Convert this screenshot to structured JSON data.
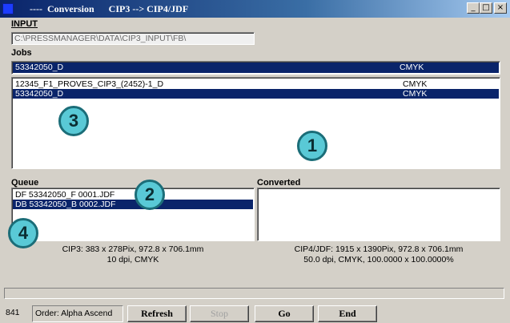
{
  "window": {
    "title": "----  Conversion      CIP3 --> CIP4/JDF",
    "minimize": "_",
    "maximize": "□",
    "close": "×"
  },
  "input": {
    "label": "INPUT",
    "path": "C:\\PRESSMANAGER\\DATA\\CIP3_INPUT\\FB\\"
  },
  "jobs": {
    "label": "Jobs",
    "selected": {
      "name": "53342050_D",
      "color": "CMYK"
    },
    "items": [
      {
        "name": "12345_F1_PROVES_CIP3_(2452)-1_D",
        "color": "CMYK"
      },
      {
        "name": "53342050_D",
        "color": "CMYK"
      }
    ]
  },
  "queue": {
    "label": "Queue",
    "items": [
      "DF 53342050_F 0001.JDF",
      "DB 53342050_B 0002.JDF"
    ],
    "info_line1": "CIP3:  383 x  278Pix, 972.8 x 706.1mm",
    "info_line2": "10 dpi, CMYK"
  },
  "converted": {
    "label": "Converted",
    "info_line1": "CIP4/JDF: 1915 x 1390Pix, 972.8 x 706.1mm",
    "info_line2": "50.0 dpi, CMYK, 100.0000 x 100.0000%"
  },
  "callouts": [
    "1",
    "2",
    "3",
    "4"
  ],
  "statusbar": {
    "count": "841",
    "order": "Order: Alpha Ascend",
    "refresh": "Refresh",
    "stop": "Stop",
    "go": "Go",
    "end": "End"
  },
  "colors": {
    "selection": "#0a246a",
    "callout_fill": "#59c9d6",
    "callout_border": "#1b6d78"
  }
}
